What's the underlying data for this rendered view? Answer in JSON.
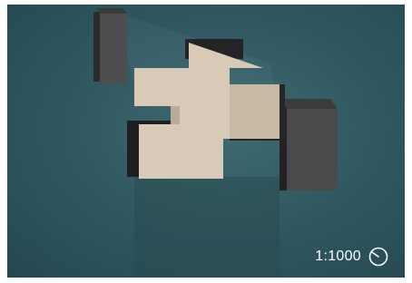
{
  "viewer": {
    "scale_label": "1:1000",
    "compass_icon": "compass-icon"
  },
  "colors": {
    "background": "#2f565f",
    "building_top": "#d9cbb7",
    "building_side": "#b9ab98",
    "tower_face": "#4a4a4c",
    "tower_top": "#3a3a3c",
    "shadow": "#1e3238"
  }
}
